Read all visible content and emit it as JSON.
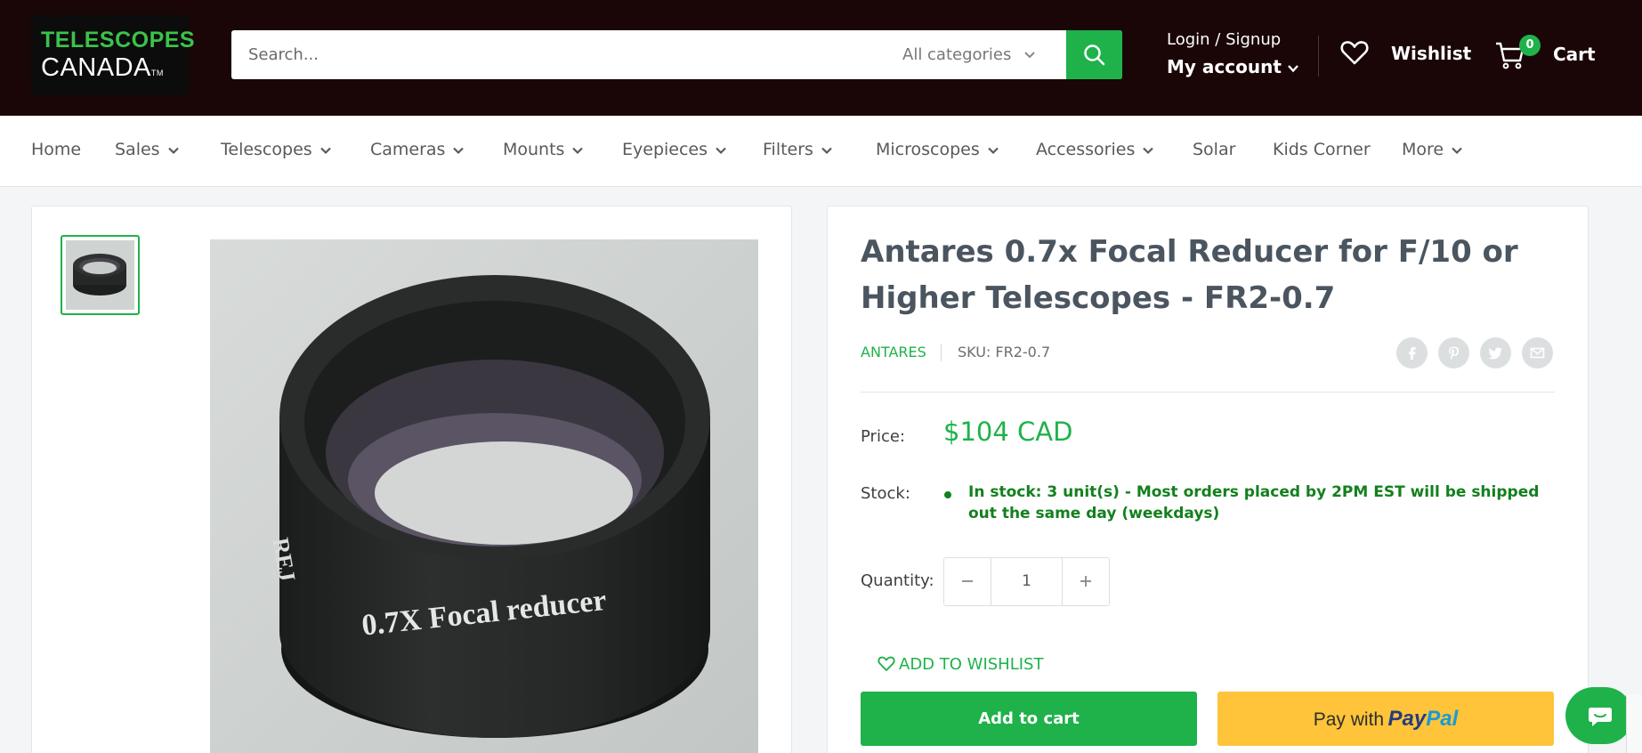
{
  "header": {
    "logo_line1": "TELESCOPES",
    "logo_line2": "CANADA",
    "logo_mark": "TM",
    "search_placeholder": "Search...",
    "category_select": "All categories",
    "login_label": "Login / Signup",
    "account_label": "My account",
    "wishlist_label": "Wishlist",
    "cart_label": "Cart",
    "cart_count": "0"
  },
  "nav": {
    "items": [
      {
        "label": "Home",
        "dropdown": false
      },
      {
        "label": "Sales",
        "dropdown": true
      },
      {
        "label": "Telescopes",
        "dropdown": true
      },
      {
        "label": "Cameras",
        "dropdown": true
      },
      {
        "label": "Mounts",
        "dropdown": true
      },
      {
        "label": "Eyepieces",
        "dropdown": true
      },
      {
        "label": "Filters",
        "dropdown": true
      },
      {
        "label": "Microscopes",
        "dropdown": true
      },
      {
        "label": "Accessories",
        "dropdown": true
      },
      {
        "label": "Solar",
        "dropdown": false
      },
      {
        "label": "Kids Corner",
        "dropdown": false
      },
      {
        "label": "More",
        "dropdown": true
      }
    ]
  },
  "product": {
    "title": "Antares 0.7x Focal Reducer for F/10 or Higher Telescopes - FR2-0.7",
    "vendor": "ANTARES",
    "sku": "SKU: FR2-0.7",
    "price_label": "Price:",
    "price": "$104 CAD",
    "stock_label": "Stock:",
    "stock_text": "In stock: 3 unit(s) - Most orders placed by 2PM EST will be shipped out the same day (weekdays)",
    "quantity_label": "Quantity:",
    "quantity": "1",
    "add_to_wishlist": "ADD TO WISHLIST",
    "add_to_cart": "Add to cart",
    "paypal_prefix": "Pay with",
    "paypal_brand1": "Pay",
    "paypal_brand2": "Pal",
    "image_engraving": "0.7X Focal reducer",
    "share_icons": [
      "facebook-icon",
      "pinterest-icon",
      "twitter-icon",
      "email-icon"
    ]
  },
  "colors": {
    "header_bg": "#1a0606",
    "accent": "#1fb24a",
    "stock_green": "#13801e",
    "paypal_yellow": "#ffc439"
  }
}
